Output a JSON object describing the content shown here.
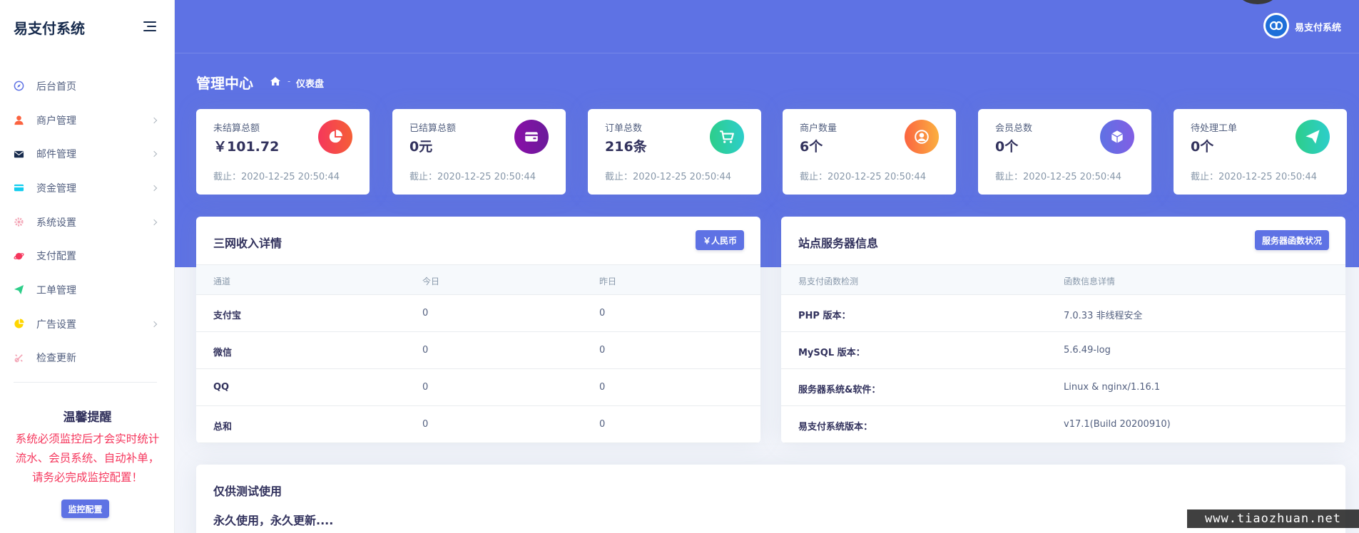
{
  "sidebar": {
    "brand": "易支付系统",
    "items": [
      {
        "label": "后台首页",
        "icon": "compass-icon",
        "color": "#5e72e4",
        "arrow": false
      },
      {
        "label": "商户管理",
        "icon": "user-icon",
        "color": "#fb6340",
        "arrow": true
      },
      {
        "label": "邮件管理",
        "icon": "envelope-icon",
        "color": "#172b4d",
        "arrow": true
      },
      {
        "label": "资金管理",
        "icon": "credit-card-icon",
        "color": "#11cdef",
        "arrow": true
      },
      {
        "label": "系统设置",
        "icon": "gear-icon",
        "color": "#f3a4b5",
        "arrow": true
      },
      {
        "label": "支付配置",
        "icon": "planet-icon",
        "color": "#f5365c",
        "arrow": false
      },
      {
        "label": "工单管理",
        "icon": "send-icon",
        "color": "#2dce89",
        "arrow": false
      },
      {
        "label": "广告设置",
        "icon": "chart-pie-icon",
        "color": "#ffd600",
        "arrow": true
      },
      {
        "label": "检查更新",
        "icon": "satisfied-icon",
        "color": "#f3a4b5",
        "arrow": false
      }
    ],
    "reminder": {
      "title": "温馨提醒",
      "text": "系统必须监控后才会实时统计流水、会员系统、自动补单，请务必完成监控配置！",
      "button": "监控配置"
    }
  },
  "header": {
    "user_name": "易支付系统",
    "page_title": "管理中心",
    "breadcrumb_sep": "-",
    "breadcrumb_current": "仪表盘"
  },
  "stats": [
    {
      "label": "未结算总额",
      "value": "￥101.72",
      "date": "截止：2020-12-25 20:50:44",
      "icon": "chart-pie-icon",
      "gradient": [
        "#f5365c",
        "#f56036"
      ]
    },
    {
      "label": "已结算总额",
      "value": "0元",
      "date": "截止：2020-12-25 20:50:44",
      "icon": "wallet-icon",
      "gradient": [
        "#8a0fa8",
        "#6a1b9a"
      ]
    },
    {
      "label": "订单总数",
      "value": "216条",
      "date": "截止：2020-12-25 20:50:44",
      "icon": "cart-icon",
      "gradient": [
        "#2dce89",
        "#2dcecc"
      ]
    },
    {
      "label": "商户数量",
      "value": "6个",
      "date": "截止：2020-12-25 20:50:44",
      "icon": "user-circle-icon",
      "gradient": [
        "#fb6340",
        "#fbb140"
      ]
    },
    {
      "label": "会员总数",
      "value": "0个",
      "date": "截止：2020-12-25 20:50:44",
      "icon": "box-icon",
      "gradient": [
        "#5e72e4",
        "#825ee4"
      ]
    },
    {
      "label": "待处理工单",
      "value": "0个",
      "date": "截止：2020-12-25 20:50:44",
      "icon": "send-icon",
      "gradient": [
        "#2dce89",
        "#2dcecc"
      ]
    }
  ],
  "income": {
    "title": "三网收入详情",
    "button": "￥人民币",
    "headers": [
      "通道",
      "今日",
      "昨日"
    ],
    "rows": [
      [
        "支付宝",
        "0",
        "0"
      ],
      [
        "微信",
        "0",
        "0"
      ],
      [
        "QQ",
        "0",
        "0"
      ],
      [
        "总和",
        "0",
        "0"
      ]
    ]
  },
  "server": {
    "title": "站点服务器信息",
    "button": "服务器函数状况",
    "headers": [
      "易支付函数检测",
      "函数信息详情"
    ],
    "rows": [
      [
        "PHP 版本：",
        "7.0.33 非线程安全"
      ],
      [
        "MySQL 版本：",
        "5.6.49-log"
      ],
      [
        "服务器系统&软件：",
        "Linux & nginx/1.16.1"
      ],
      [
        "易支付系统版本：",
        "v17.1(Build 20200910)"
      ]
    ]
  },
  "notice": {
    "title": "仅供测试使用",
    "text": "永久使用，永久更新...."
  },
  "watermark": "www.tiaozhuan.net"
}
